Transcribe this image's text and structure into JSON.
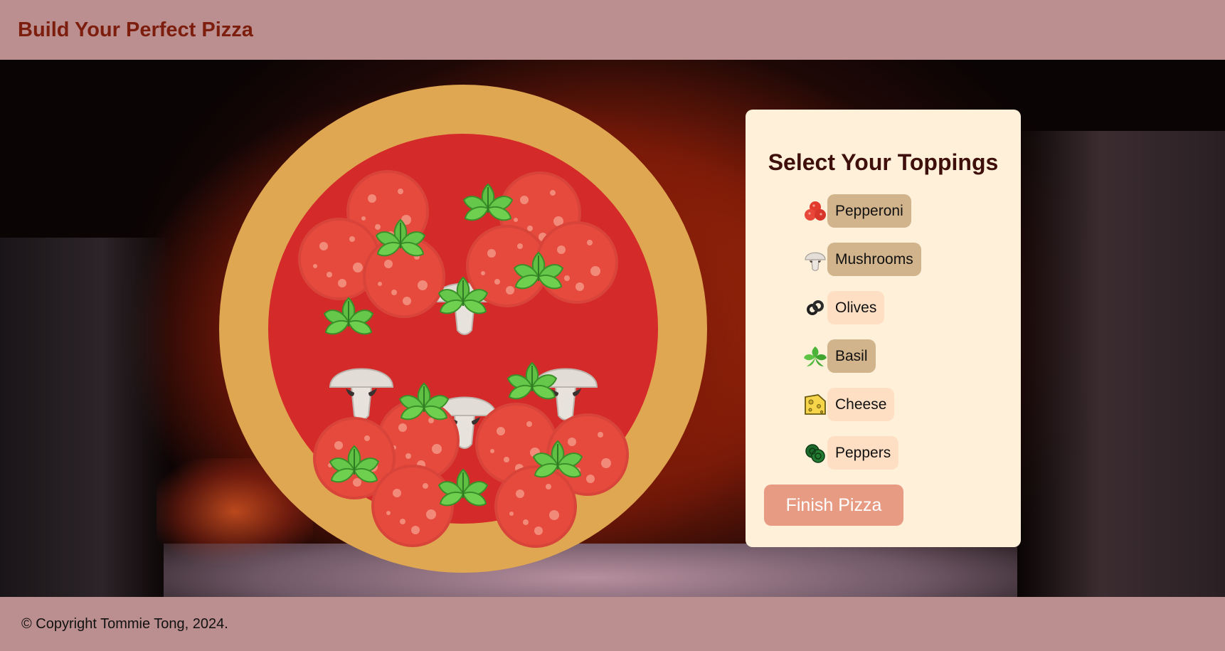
{
  "header": {
    "title": "Build Your Perfect Pizza"
  },
  "panel": {
    "title": "Select Your Toppings",
    "toppings": [
      {
        "label": "Pepperoni",
        "icon": "pepperoni-icon",
        "selected": true
      },
      {
        "label": "Mushrooms",
        "icon": "mushroom-icon",
        "selected": true
      },
      {
        "label": "Olives",
        "icon": "olive-icon",
        "selected": false
      },
      {
        "label": "Basil",
        "icon": "basil-icon",
        "selected": true
      },
      {
        "label": "Cheese",
        "icon": "cheese-icon",
        "selected": false
      },
      {
        "label": "Peppers",
        "icon": "pepper-icon",
        "selected": false
      }
    ],
    "finish_label": "Finish Pizza"
  },
  "footer": {
    "copyright": "© Copyright Tommie Tong, 2024."
  },
  "colors": {
    "header_bg": "#bb8f8f",
    "title_color": "#7c1d0d",
    "panel_bg": "#fef0d9",
    "selected_bg": "#d2b48c",
    "unselected_bg": "#ffdfc4",
    "finish_bg": "#e79b82",
    "crust": "#e0a752",
    "sauce": "#d42a2a"
  }
}
